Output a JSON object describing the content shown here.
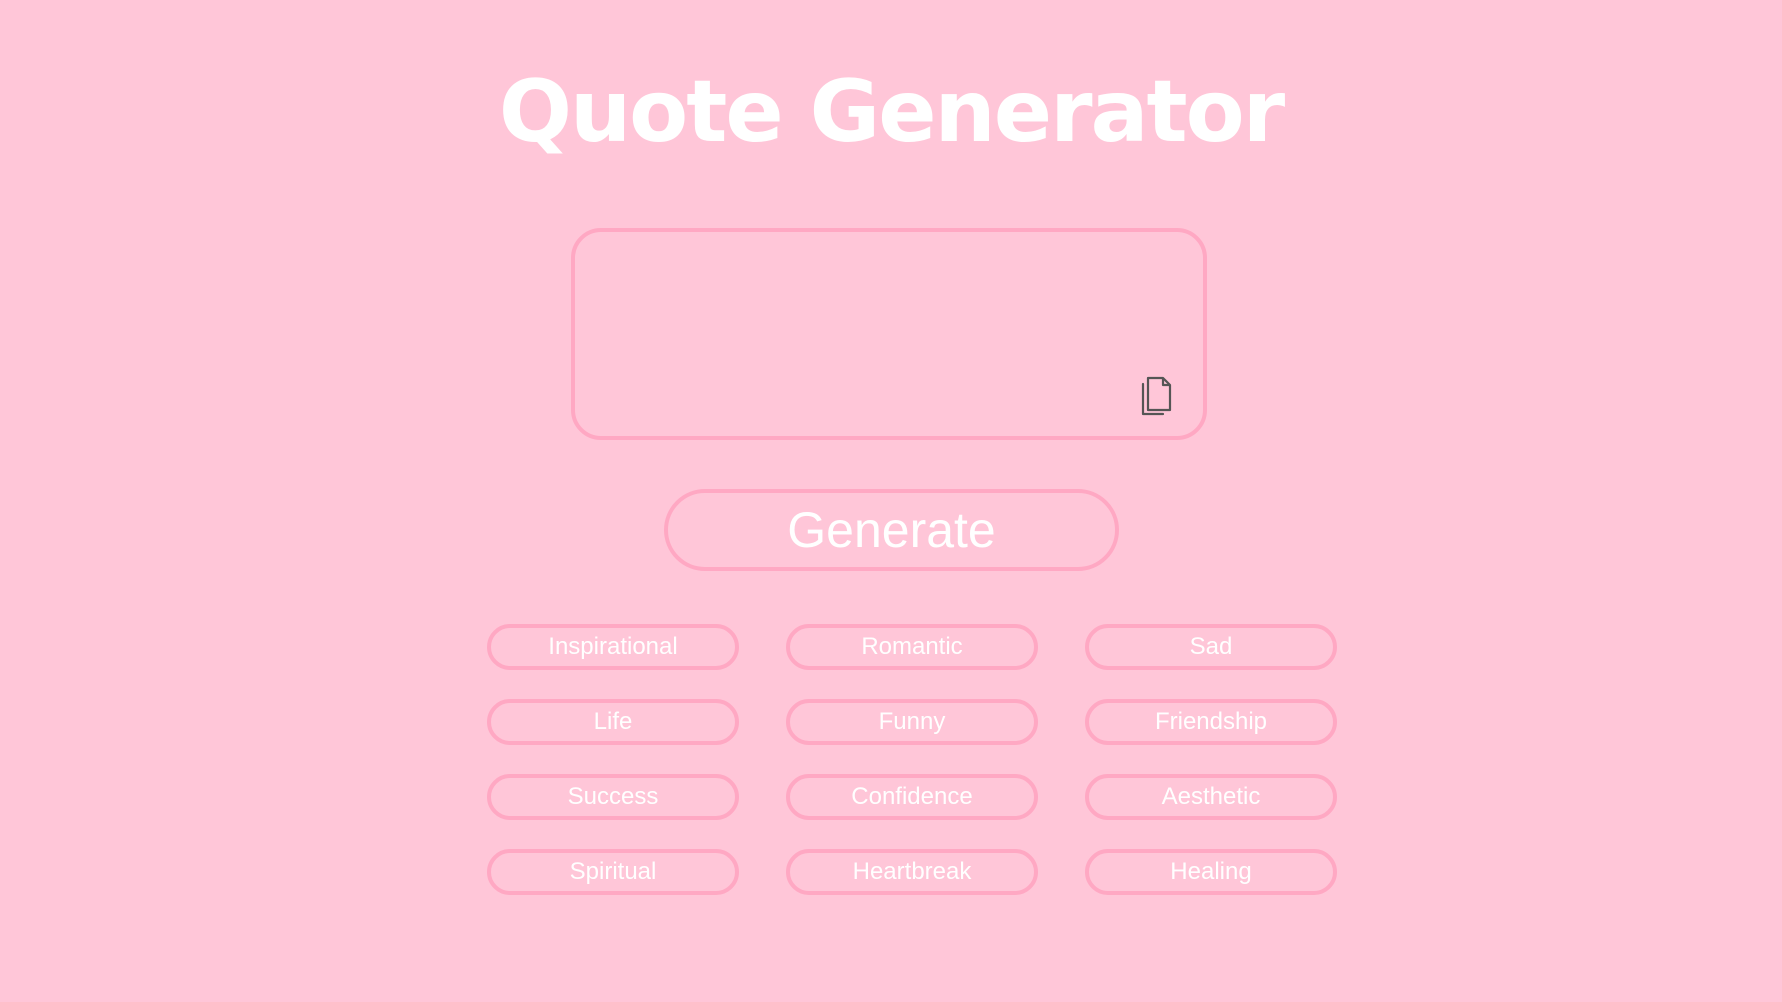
{
  "header": {
    "title": "Quote Generator"
  },
  "quote_box": {
    "text": "",
    "copy_icon": "copy-icon"
  },
  "generate": {
    "label": "Generate"
  },
  "categories": [
    {
      "label": "Inspirational"
    },
    {
      "label": "Romantic"
    },
    {
      "label": "Sad"
    },
    {
      "label": "Life"
    },
    {
      "label": "Funny"
    },
    {
      "label": "Friendship"
    },
    {
      "label": "Success"
    },
    {
      "label": "Confidence"
    },
    {
      "label": "Aesthetic"
    },
    {
      "label": "Spiritual"
    },
    {
      "label": "Heartbreak"
    },
    {
      "label": "Healing"
    }
  ],
  "colors": {
    "background": "#ffc6d8",
    "border": "#ffa8c3",
    "text": "#ffffff",
    "icon": "#555555"
  }
}
